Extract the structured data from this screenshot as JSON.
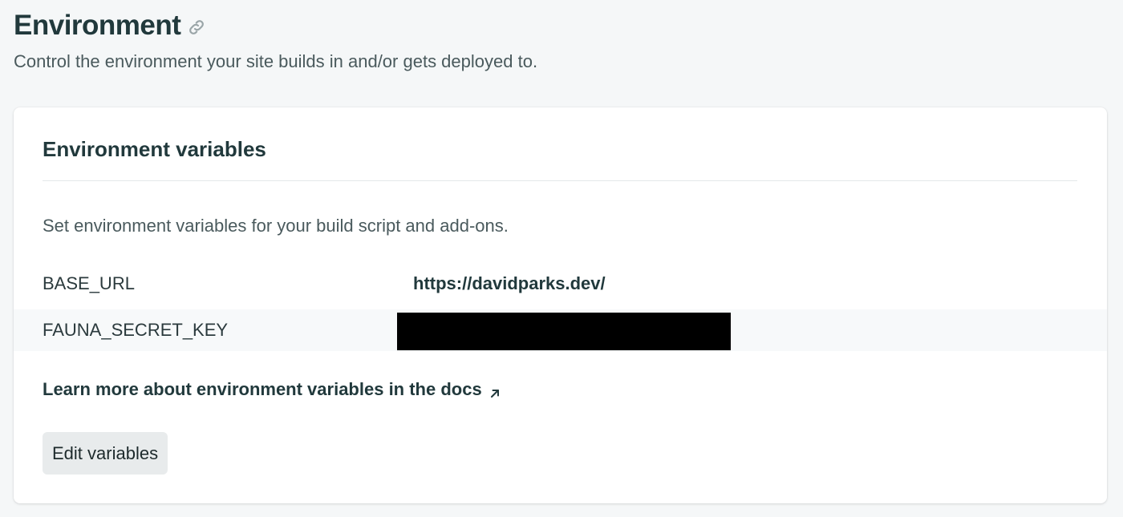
{
  "section": {
    "title": "Environment",
    "description": "Control the environment your site builds in and/or gets deployed to."
  },
  "card": {
    "title": "Environment variables",
    "description": "Set environment variables for your build script and add-ons.",
    "variables": [
      {
        "key": "BASE_URL",
        "value": "https://davidparks.dev/"
      },
      {
        "key": "FAUNA_SECRET_KEY",
        "value": ""
      }
    ],
    "docs_link_label": "Learn more about environment variables in the docs",
    "edit_button_label": "Edit variables"
  },
  "icons": {
    "title_link": "link-icon",
    "docs_external": "arrow-up-right-icon"
  },
  "colors": {
    "heading": "#21393c",
    "body_text": "#4a5a5d",
    "page_bg": "#f5f7f8",
    "card_bg": "#ffffff",
    "button_bg": "#e8ebec",
    "redaction": "#000000"
  }
}
